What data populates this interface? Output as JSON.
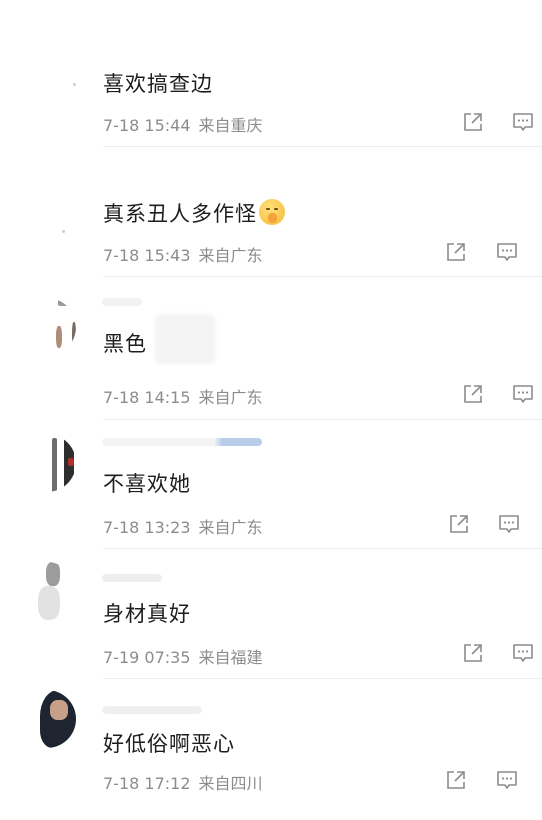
{
  "comments": [
    {
      "content": "喜欢搞查边",
      "time": "7-18 15:44",
      "location": "来自重庆",
      "emoji": "",
      "emoji_icon": ""
    },
    {
      "content": "真系丑人多作怪",
      "time": "7-18 15:43",
      "location": "来自广东",
      "emoji": "",
      "emoji_icon": "shushing-face-emoji"
    },
    {
      "content": "黑色",
      "time": "7-18 14:15",
      "location": "来自广东",
      "emoji": "",
      "emoji_icon": ""
    },
    {
      "content": "不喜欢她",
      "time": "7-18 13:23",
      "location": "来自广东",
      "emoji": "",
      "emoji_icon": ""
    },
    {
      "content": "身材真好",
      "time": "7-19 07:35",
      "location": "来自福建",
      "emoji": "",
      "emoji_icon": ""
    },
    {
      "content": "好低俗啊恶心",
      "time": "7-18 17:12",
      "location": "来自四川",
      "emoji": "",
      "emoji_icon": ""
    }
  ],
  "icons": {
    "share": "share-icon",
    "reply": "reply-icon"
  },
  "colors": {
    "content_text": "#1e1e1e",
    "meta_text": "#8c8c8c",
    "icon_stroke": "#8c8c8c",
    "divider": "#ececec"
  }
}
